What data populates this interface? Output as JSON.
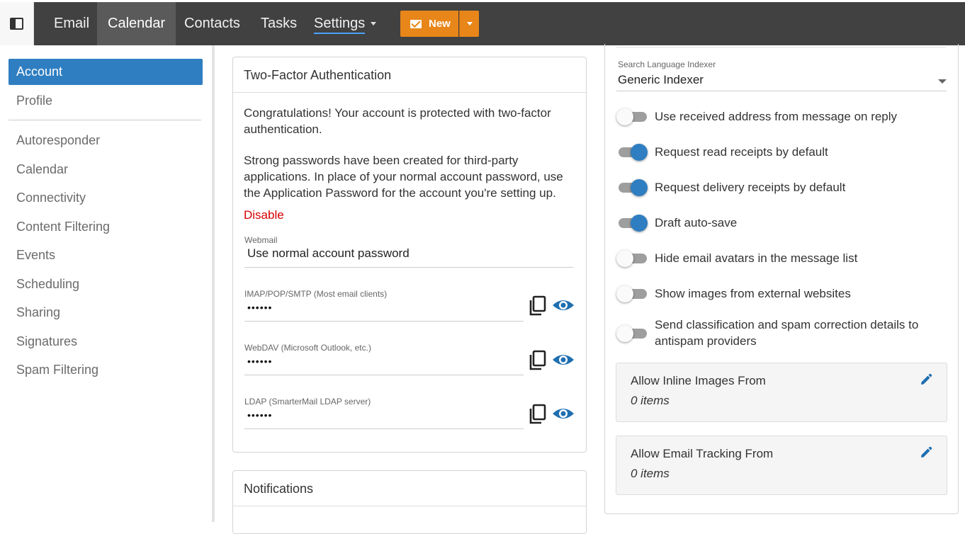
{
  "nav": {
    "items": [
      {
        "label": "Email"
      },
      {
        "label": "Calendar"
      },
      {
        "label": "Contacts"
      },
      {
        "label": "Tasks"
      },
      {
        "label": "Settings"
      }
    ],
    "new_label": "New",
    "accent": "#e8861a"
  },
  "sidebar": {
    "items": [
      {
        "label": "Account"
      },
      {
        "label": "Profile"
      },
      {
        "label": "Autoresponder"
      },
      {
        "label": "Calendar"
      },
      {
        "label": "Connectivity"
      },
      {
        "label": "Content Filtering"
      },
      {
        "label": "Events"
      },
      {
        "label": "Scheduling"
      },
      {
        "label": "Sharing"
      },
      {
        "label": "Signatures"
      },
      {
        "label": "Spam Filtering"
      }
    ],
    "active_color": "#2f7ec1"
  },
  "two_factor": {
    "title": "Two-Factor Authentication",
    "para1": "Congratulations! Your account is protected with two-factor authentication.",
    "para2": "Strong passwords have been created for third-party applications. In place of your normal account password, use the Application Password for the account you're setting up.",
    "disable_label": "Disable",
    "webmail_label": "Webmail",
    "webmail_value": "Use normal account password",
    "passwords": [
      {
        "label": "IMAP/POP/SMTP (Most email clients)",
        "value": "••••••"
      },
      {
        "label": "WebDAV (Microsoft Outlook, etc.)",
        "value": "••••••"
      },
      {
        "label": "LDAP (SmarterMail LDAP server)",
        "value": "••••••"
      }
    ]
  },
  "notifications": {
    "title": "Notifications"
  },
  "right": {
    "indexer_label": "Search Language Indexer",
    "indexer_value": "Generic Indexer",
    "toggles": [
      {
        "label": "Use received address from message on reply",
        "on": false
      },
      {
        "label": "Request read receipts by default",
        "on": true
      },
      {
        "label": "Request delivery receipts by default",
        "on": true
      },
      {
        "label": "Draft auto-save",
        "on": true
      },
      {
        "label": "Hide email avatars in the message list",
        "on": false
      },
      {
        "label": "Show images from external websites",
        "on": false
      },
      {
        "label": "Send classification and spam correction details to antispam providers",
        "on": false
      }
    ],
    "inline_images": {
      "title": "Allow Inline Images From",
      "count": "0 items"
    },
    "email_tracking": {
      "title": "Allow Email Tracking From",
      "count": "0 items"
    }
  }
}
